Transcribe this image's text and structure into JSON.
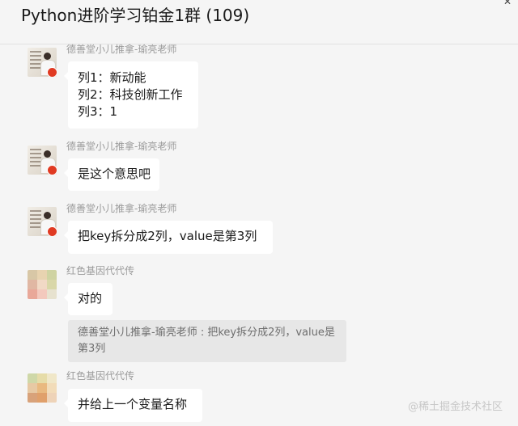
{
  "chat": {
    "title": "Python进阶学习铂金1群 (109)",
    "icons": {
      "more": "more-icon",
      "close": "close-icon"
    }
  },
  "messages": [
    {
      "sender": "德善堂小儿推拿-瑜亮老师",
      "avatar": "teacher-avatar",
      "lines": [
        "列1：新动能",
        "列2：科技创新工作",
        "列3：1"
      ]
    },
    {
      "sender": "德善堂小儿推拿-瑜亮老师",
      "avatar": "teacher-avatar",
      "lines": [
        "是这个意思吧"
      ]
    },
    {
      "sender": "德善堂小儿推拿-瑜亮老师",
      "avatar": "teacher-avatar",
      "lines": [
        "把key拆分成2列，value是第3列"
      ]
    },
    {
      "sender": "红色基因代代传",
      "avatar": "pixelated-avatar",
      "lines": [
        "对的"
      ]
    },
    {
      "sender": "红色基因代代传",
      "avatar": "pixelated-avatar",
      "lines": [
        "并给上一个变量名称"
      ]
    }
  ],
  "quote": {
    "text": "德善堂小儿推拿-瑜亮老师 : 把key拆分成2列，value是第3列"
  },
  "watermark": "@稀土掘金技术社区",
  "colors": {
    "background": "#f5f5f5",
    "bubble": "#ffffff",
    "quote_bg": "#e7e7e7",
    "sender_text": "#9b9b9b",
    "badge_red": "#e03a22"
  }
}
